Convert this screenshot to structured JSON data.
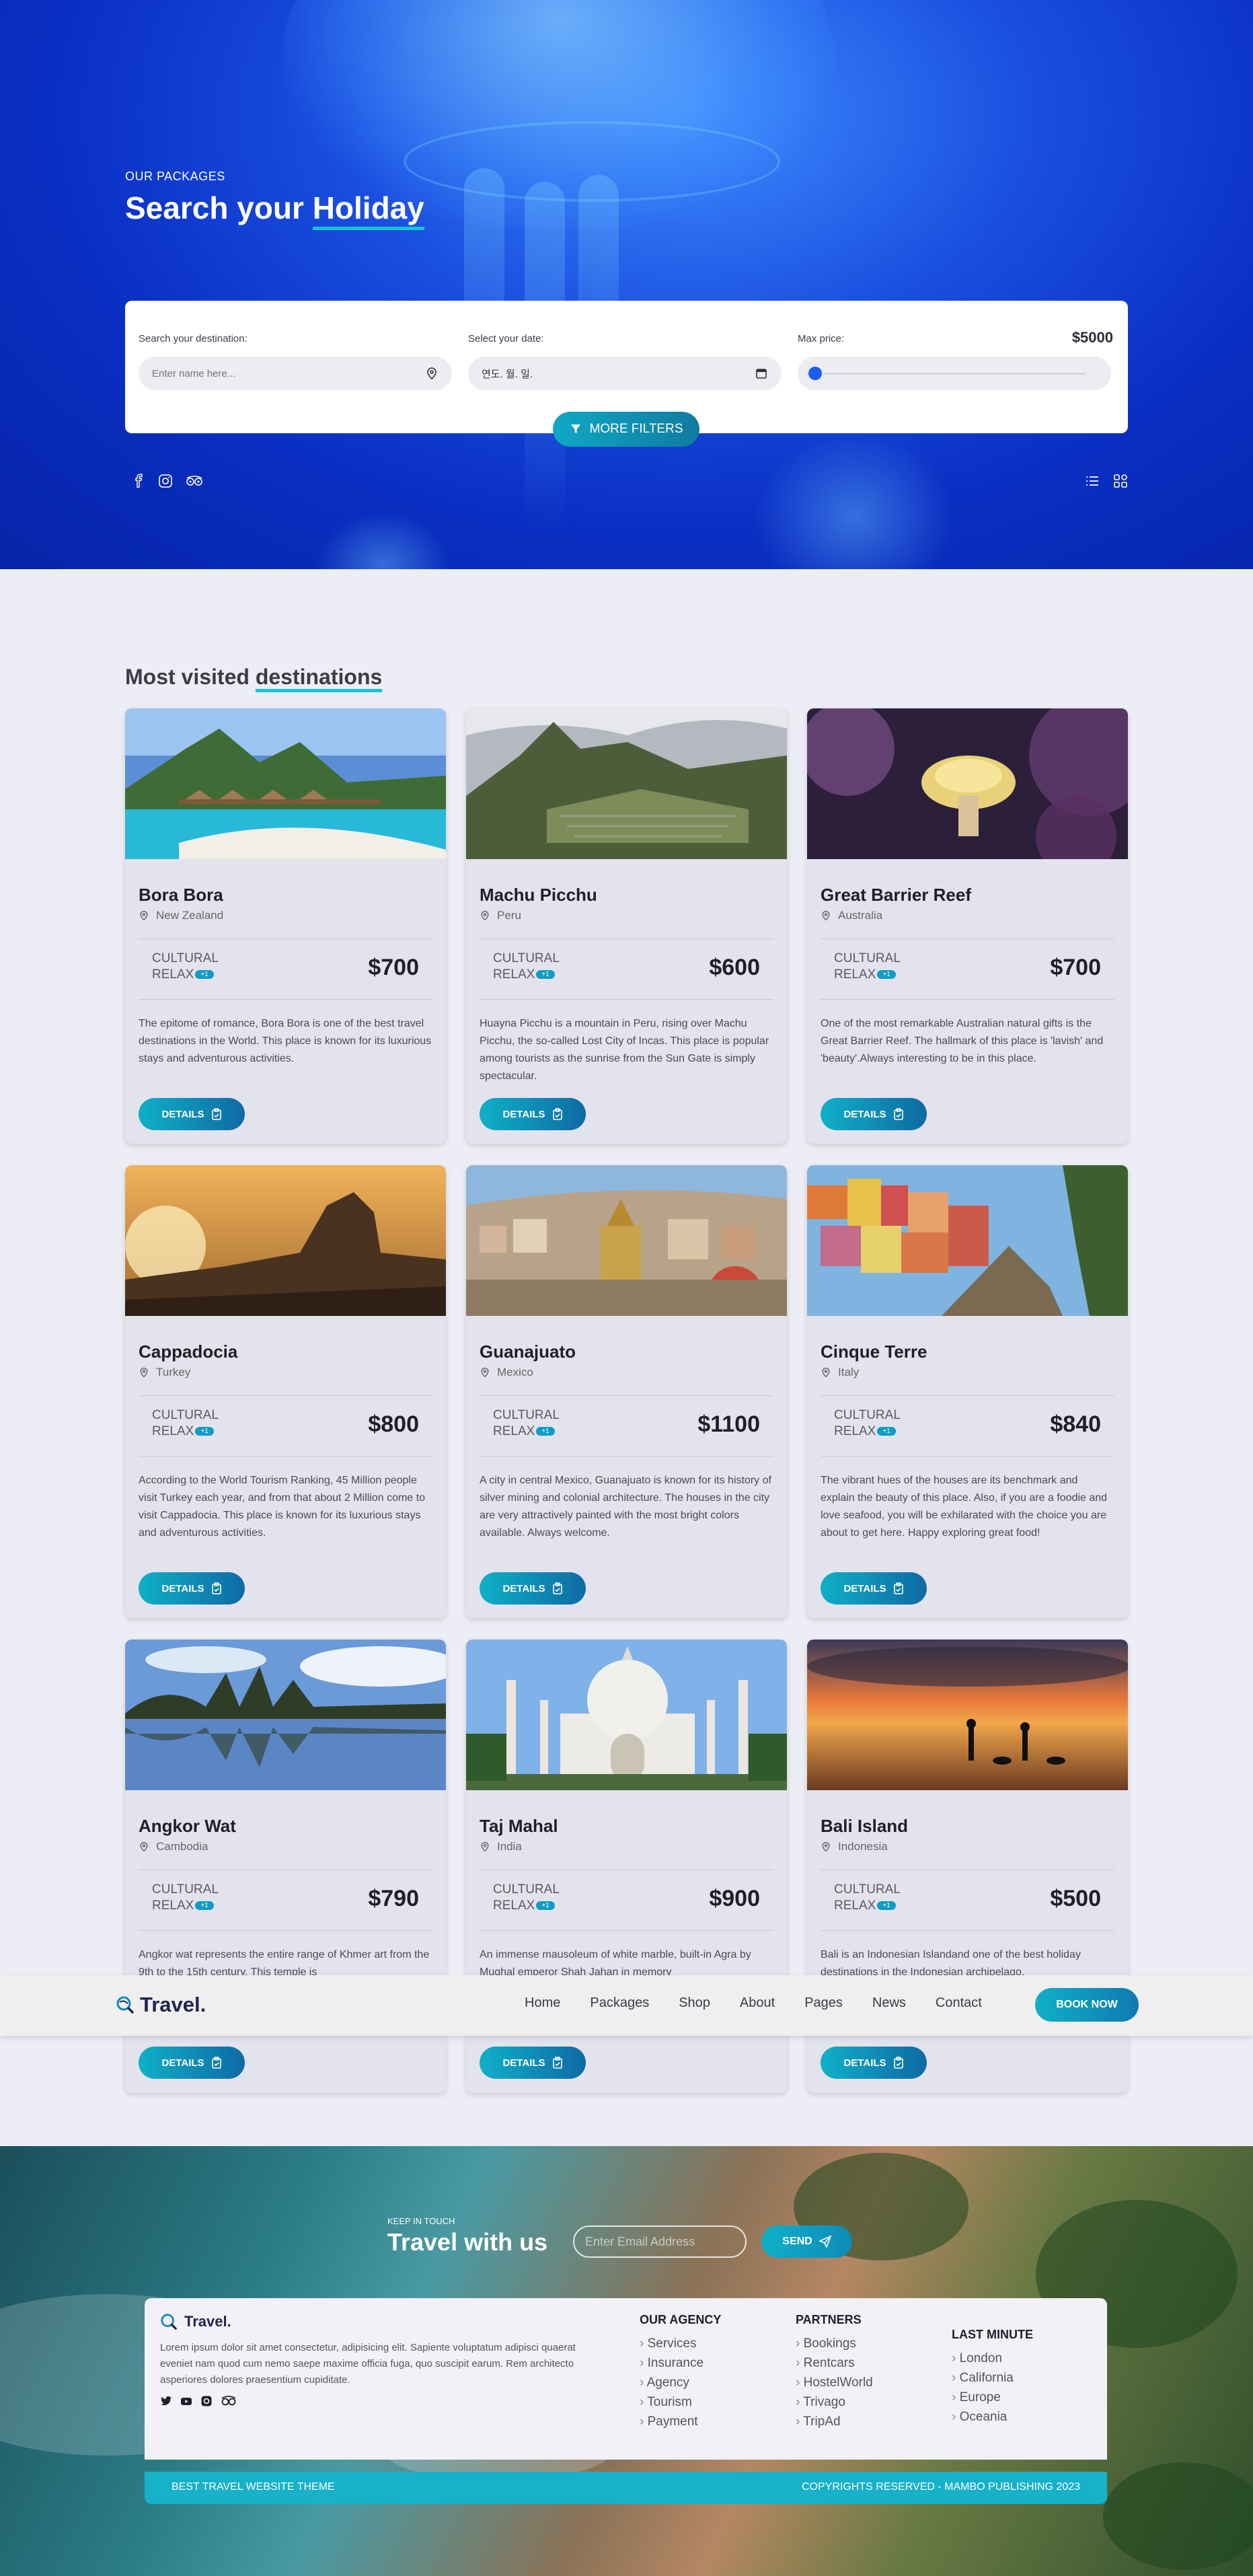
{
  "hero": {
    "eyebrow": "OUR PACKAGES",
    "title_start": "Search your ",
    "title_underlined": "Holiday",
    "destination_label": "Search your destination:",
    "destination_placeholder": "Enter name here...",
    "date_label": "Select your date:",
    "date_value": "연도. 월. 일.",
    "price_label": "Max price:",
    "price_value": "$5000",
    "price_slider_fraction": 0,
    "more_filters": "MORE FILTERS"
  },
  "section": {
    "title_start": "Most visited ",
    "title_underlined": "destinations"
  },
  "cards": [
    {
      "name": "Bora Bora",
      "location": "New Zealand",
      "tag1": "CULTURAL",
      "tag2": "RELAX",
      "badge": "+1",
      "price": "$700",
      "desc": "The epitome of romance, Bora Bora is one of the best travel destinations in the World. This place is known for its luxurious stays and adventurous activities.",
      "button": "DETAILS"
    },
    {
      "name": "Machu Picchu",
      "location": "Peru",
      "tag1": "CULTURAL",
      "tag2": "RELAX",
      "badge": "+1",
      "price": "$600",
      "desc": "Huayna Picchu is a mountain in Peru, rising over Machu Picchu, the so-called Lost City of Incas. This place is popular among tourists as the sunrise from the Sun Gate is simply spectacular.",
      "button": "DETAILS"
    },
    {
      "name": "Great Barrier Reef",
      "location": "Australia",
      "tag1": "CULTURAL",
      "tag2": "RELAX",
      "badge": "+1",
      "price": "$700",
      "desc": "One of the most remarkable Australian natural gifts is the Great Barrier Reef. The hallmark of this place is 'lavish' and 'beauty'.Always interesting to be in this place.",
      "button": "DETAILS"
    },
    {
      "name": "Cappadocia",
      "location": "Turkey",
      "tag1": "CULTURAL",
      "tag2": "RELAX",
      "badge": "+1",
      "price": "$800",
      "desc": "According to the World Tourism Ranking, 45 Million people visit Turkey each year, and from that about 2 Million come to visit Cappadocia. This place is known for its luxurious stays and adventurous activities.",
      "button": "DETAILS"
    },
    {
      "name": "Guanajuato",
      "location": "Mexico",
      "tag1": "CULTURAL",
      "tag2": "RELAX",
      "badge": "+1",
      "price": "$1100",
      "desc": "A city in central Mexico, Guanajuato is known for its history of silver mining and colonial architecture. The houses in the city are very attractively painted with the most bright colors available. Always welcome.",
      "button": "DETAILS"
    },
    {
      "name": "Cinque Terre",
      "location": "Italy",
      "tag1": "CULTURAL",
      "tag2": "RELAX",
      "badge": "+1",
      "price": "$840",
      "desc": "The vibrant hues of the houses are its benchmark and explain the beauty of this place. Also, if you are a foodie and love seafood, you will be exhilarated with the choice you are about to get here. Happy exploring great food!",
      "button": "DETAILS"
    },
    {
      "name": "Angkor Wat",
      "location": "Cambodia",
      "tag1": "CULTURAL",
      "tag2": "RELAX",
      "badge": "+1",
      "price": "$790",
      "desc": "Angkor wat represents the entire range of Khmer art from the 9th to the 15th century. This temple is",
      "button": "DETAILS"
    },
    {
      "name": "Taj Mahal",
      "location": "India",
      "tag1": "CULTURAL",
      "tag2": "RELAX",
      "badge": "+1",
      "price": "$900",
      "desc": "An immense mausoleum of white marble, built-in Agra by Mughal emperor Shah Jahan in memory",
      "button": "DETAILS"
    },
    {
      "name": "Bali Island",
      "location": "Indonesia",
      "tag1": "CULTURAL",
      "tag2": "RELAX",
      "badge": "+1",
      "price": "$500",
      "desc": "Bali is an Indonesian Islandand one of the best holiday destinations in the Indonesian archipelago.",
      "button": "DETAILS"
    }
  ],
  "nav": {
    "logo": "Travel.",
    "links": [
      "Home",
      "Packages",
      "Shop",
      "About",
      "Pages",
      "News",
      "Contact"
    ],
    "book": "BOOK NOW"
  },
  "footer": {
    "keep": "KEEP IN TOUCH",
    "title": "Travel with us",
    "email_placeholder": "Enter Email Address",
    "send": "SEND",
    "logo": "Travel.",
    "about": "Lorem ipsum dolor sit amet consectetur, adipisicing elit. Sapiente voluptatum adipisci quaerat eveniet nam quod cum nemo saepe maxime officia fuga, quo suscipit earum. Rem architecto asperiores dolores praesentium cupiditate.",
    "agency_title": "OUR AGENCY",
    "agency": [
      "Services",
      "Insurance",
      "Agency",
      "Tourism",
      "Payment"
    ],
    "partners_title": "PARTNERS",
    "partners": [
      "Bookings",
      "Rentcars",
      "HostelWorld",
      "Trivago",
      "TripAd"
    ],
    "last_title": "LAST MINUTE",
    "last": [
      "London",
      "California",
      "Europe",
      "Oceania"
    ],
    "bar_left": "BEST TRAVEL WEBSITE THEME",
    "bar_right": "COPYRIGHTS RESERVED - MAMBO PUBLISHING 2023"
  },
  "colors": {
    "accent": "#12c6d6",
    "button": "#0fa9c6",
    "hero": "#0a2fc4"
  }
}
